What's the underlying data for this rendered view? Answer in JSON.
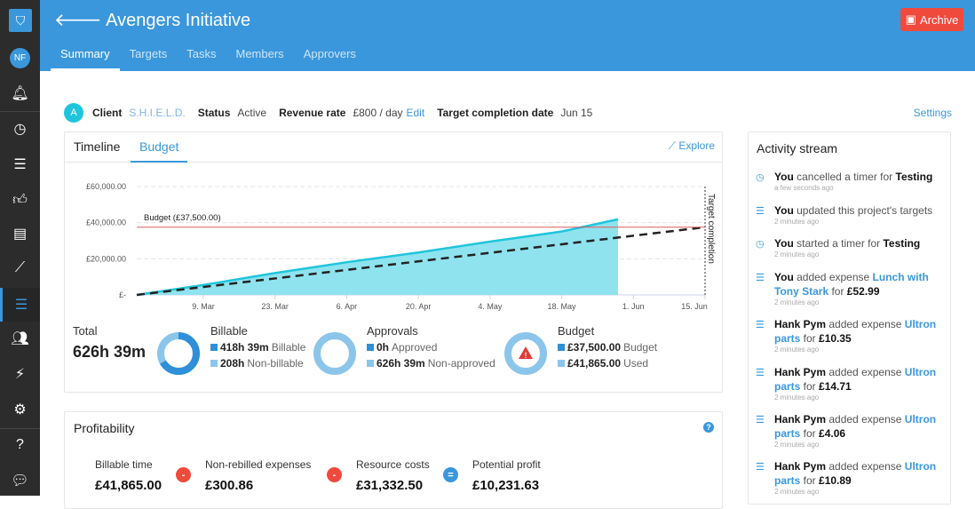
{
  "sidebar": {
    "avatar": "NF",
    "items": [
      "bell",
      "clock",
      "database",
      "thumbs-up",
      "document",
      "chart",
      "targets",
      "users",
      "plug",
      "gear",
      "help",
      "chat"
    ]
  },
  "header": {
    "title": "Avengers Initiative",
    "archive_label": "Archive",
    "tabs": [
      "Summary",
      "Targets",
      "Tasks",
      "Members",
      "Approvers"
    ]
  },
  "info": {
    "client_initial": "A",
    "client_label": "Client",
    "client_value": "S.H.I.E.L.D.",
    "status_label": "Status",
    "status_value": "Active",
    "rate_label": "Revenue rate",
    "rate_value": "£800 / day",
    "edit": "Edit",
    "target_label": "Target completion date",
    "target_value": "Jun 15",
    "settings": "Settings"
  },
  "card": {
    "tabs": [
      "Timeline",
      "Budget"
    ],
    "explore": "Explore"
  },
  "chart_data": {
    "type": "area",
    "y_ticks": [
      "£-",
      "£20,000.00",
      "£40,000.00",
      "£60,000.00"
    ],
    "ylim": [
      0,
      60000
    ],
    "x_ticks": [
      "9. Mar",
      "23. Mar",
      "6. Apr",
      "20. Apr",
      "4. May",
      "18. May",
      "1. Jun",
      "15. Jun"
    ],
    "xlim": [
      "2015-02-24",
      "2015-06-15"
    ],
    "series": [
      {
        "type": "area",
        "color": "#1ec5dc",
        "points": [
          [
            "2015-02-24",
            0
          ],
          [
            "2015-03-09",
            5500
          ],
          [
            "2015-03-23",
            12100
          ],
          [
            "2015-04-06",
            18100
          ],
          [
            "2015-04-20",
            23500
          ],
          [
            "2015-05-04",
            29500
          ],
          [
            "2015-05-18",
            35100
          ],
          [
            "2015-05-29",
            41865
          ]
        ]
      },
      {
        "type": "dashed",
        "color": "#222",
        "points": [
          [
            "2015-02-24",
            0
          ],
          [
            "2015-06-15",
            37500
          ]
        ]
      }
    ],
    "budget_line": {
      "value": 37500,
      "label": "Budget (£37,500.00)",
      "color": "#e05a5a"
    },
    "target_line": {
      "date": "2015-06-15",
      "label": "Target completion"
    },
    "grid": true
  },
  "stats": {
    "total_label": "Total",
    "total_value": "626h 39m",
    "billable_fraction": 0.668,
    "billable": {
      "label": "Billable",
      "a_value": "418h 39m",
      "a_label": "Billable",
      "b_value": "208h",
      "b_label": "Non-billable"
    },
    "approvals": {
      "label": "Approvals",
      "a_value": "0h",
      "a_label": "Approved",
      "b_value": "626h 39m",
      "b_label": "Non-approved"
    },
    "budget": {
      "label": "Budget",
      "a_value": "£37,500.00",
      "a_label": "Budget",
      "b_value": "£41,865.00",
      "b_label": "Used"
    }
  },
  "profit": {
    "title": "Profitability",
    "items": [
      {
        "label": "Billable time",
        "value": "£41,865.00"
      },
      {
        "label": "Non-rebilled expenses",
        "value": "£300.86"
      },
      {
        "label": "Resource costs",
        "value": "£31,332.50"
      },
      {
        "label": "Potential profit",
        "value": "£10,231.63"
      }
    ],
    "ops": [
      "-",
      "-",
      "="
    ]
  },
  "activity": {
    "title": "Activity stream",
    "items": [
      {
        "icon": "clock",
        "who": "You",
        "text": " cancelled a timer for ",
        "link": "",
        "bold": "Testing",
        "time": "a few seconds ago"
      },
      {
        "icon": "targets",
        "who": "You",
        "text": " updated this project's targets",
        "link": "",
        "bold": "",
        "time": "2 minutes ago"
      },
      {
        "icon": "clock",
        "who": "You",
        "text": " started a timer for ",
        "link": "",
        "bold": "Testing",
        "time": "2 minutes ago"
      },
      {
        "icon": "database",
        "who": "You",
        "text": " added expense ",
        "link": "Lunch with Tony Stark",
        "for": " for ",
        "bold": "£52.99",
        "time": "2 minutes ago"
      },
      {
        "icon": "database",
        "who": "Hank Pym",
        "text": " added expense ",
        "link": "Ultron parts",
        "for": " for ",
        "bold": "£10.35",
        "time": "2 minutes ago"
      },
      {
        "icon": "database",
        "who": "Hank Pym",
        "text": " added expense ",
        "link": "Ultron parts",
        "for": " for ",
        "bold": "£14.71",
        "time": "2 minutes ago"
      },
      {
        "icon": "database",
        "who": "Hank Pym",
        "text": " added expense ",
        "link": "Ultron parts",
        "for": " for ",
        "bold": "£4.06",
        "time": "2 minutes ago"
      },
      {
        "icon": "database",
        "who": "Hank Pym",
        "text": " added expense ",
        "link": "Ultron parts",
        "for": " for ",
        "bold": "£10.89",
        "time": "2 minutes ago"
      }
    ]
  }
}
